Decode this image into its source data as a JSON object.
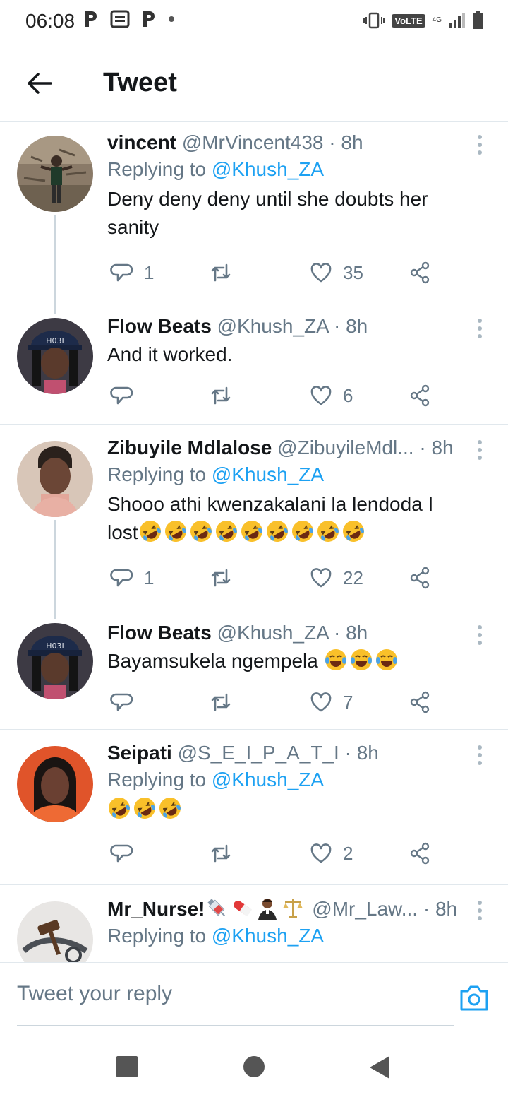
{
  "status_bar": {
    "time": "06:08",
    "volte": "VoLTE",
    "network": "4G"
  },
  "header": {
    "title": "Tweet"
  },
  "tweets": [
    {
      "name": "vincent",
      "handle": "@MrVincent438",
      "time": "8h",
      "replying_label": "Replying to",
      "replying_to": "@Khush_ZA",
      "text": "Deny deny deny until she doubts her sanity",
      "replies": "1",
      "retweets": "",
      "likes": "35"
    },
    {
      "name": "Flow Beats",
      "handle": "@Khush_ZA",
      "time": "8h",
      "text": "And it worked.",
      "replies": "",
      "retweets": "",
      "likes": "6"
    },
    {
      "name": "Zibuyile Mdlalose",
      "handle": "@ZibuyileMdl...",
      "time": "8h",
      "replying_label": "Replying to",
      "replying_to": "@Khush_ZA",
      "text": "Shooo athi kwenzakalani la lendoda I lost",
      "emoji": "rolling-on-floor-laughing",
      "emoji_count": 9,
      "replies": "1",
      "retweets": "",
      "likes": "22"
    },
    {
      "name": "Flow Beats",
      "handle": "@Khush_ZA",
      "time": "8h",
      "text": "Bayamsukela ngempela",
      "emoji": "face-with-tears-of-joy",
      "emoji_count": 3,
      "replies": "",
      "retweets": "",
      "likes": "7"
    },
    {
      "name": "Seipati",
      "handle": "@S_E_I_P_A_T_I",
      "time": "8h",
      "replying_label": "Replying to",
      "replying_to": "@Khush_ZA",
      "text": "",
      "emoji": "rolling-on-floor-laughing",
      "emoji_count": 3,
      "replies": "",
      "retweets": "",
      "likes": "2"
    },
    {
      "name": "Mr_Nurse!",
      "name_emoji": [
        "syringe",
        "pill",
        "judge",
        "balance-scale"
      ],
      "handle": "@Mr_Law...",
      "time": "8h",
      "replying_label": "Replying to",
      "replying_to": "@Khush_ZA"
    }
  ],
  "reply_bar": {
    "placeholder": "Tweet your reply"
  },
  "colors": {
    "accent": "#1da1f2",
    "secondary_text": "#657786",
    "divider": "#e1e8ed"
  },
  "icons": [
    "back-arrow-icon",
    "reply-icon",
    "retweet-icon",
    "like-icon",
    "share-icon",
    "more-icon",
    "camera-icon",
    "home-square-icon",
    "circle-home-icon",
    "back-triangle-icon"
  ]
}
